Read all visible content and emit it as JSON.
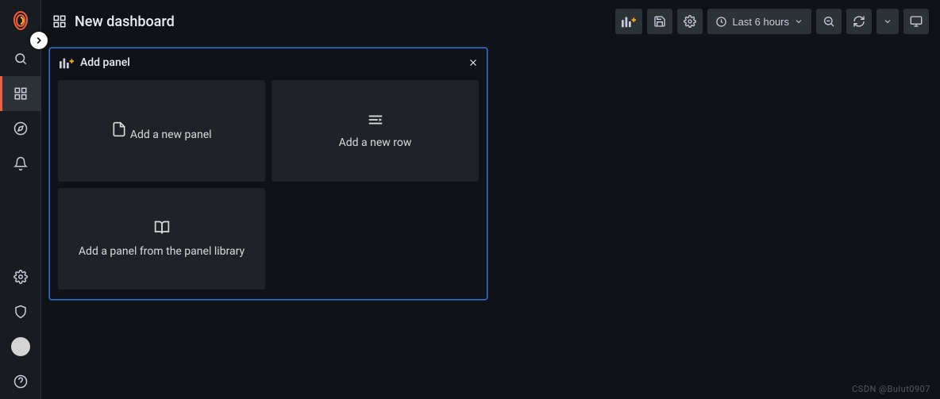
{
  "app": {
    "name": "Grafana"
  },
  "header": {
    "title": "New dashboard",
    "time_range": "Last 6 hours"
  },
  "toolbar": {
    "add_panel_tip": "Add panel",
    "save_tip": "Save dashboard",
    "settings_tip": "Dashboard settings",
    "zoom_out_tip": "Zoom out",
    "refresh_tip": "Refresh",
    "cycle_view_tip": "Cycle view mode"
  },
  "panel": {
    "title": "Add panel",
    "options": {
      "new_panel": "Add a new panel",
      "new_row": "Add a new row",
      "library": "Add a panel from the panel library"
    },
    "close_tip": "Close"
  },
  "sidebar": {
    "items": [
      {
        "name": "search",
        "label": "Search"
      },
      {
        "name": "dashboards",
        "label": "Dashboards"
      },
      {
        "name": "explore",
        "label": "Explore"
      },
      {
        "name": "alerting",
        "label": "Alerting"
      }
    ],
    "footer": [
      {
        "name": "configuration",
        "label": "Configuration"
      },
      {
        "name": "server-admin",
        "label": "Server Admin"
      },
      {
        "name": "profile",
        "label": "Profile"
      },
      {
        "name": "help",
        "label": "Help"
      }
    ]
  },
  "watermark": "CSDN @Bulut0907"
}
